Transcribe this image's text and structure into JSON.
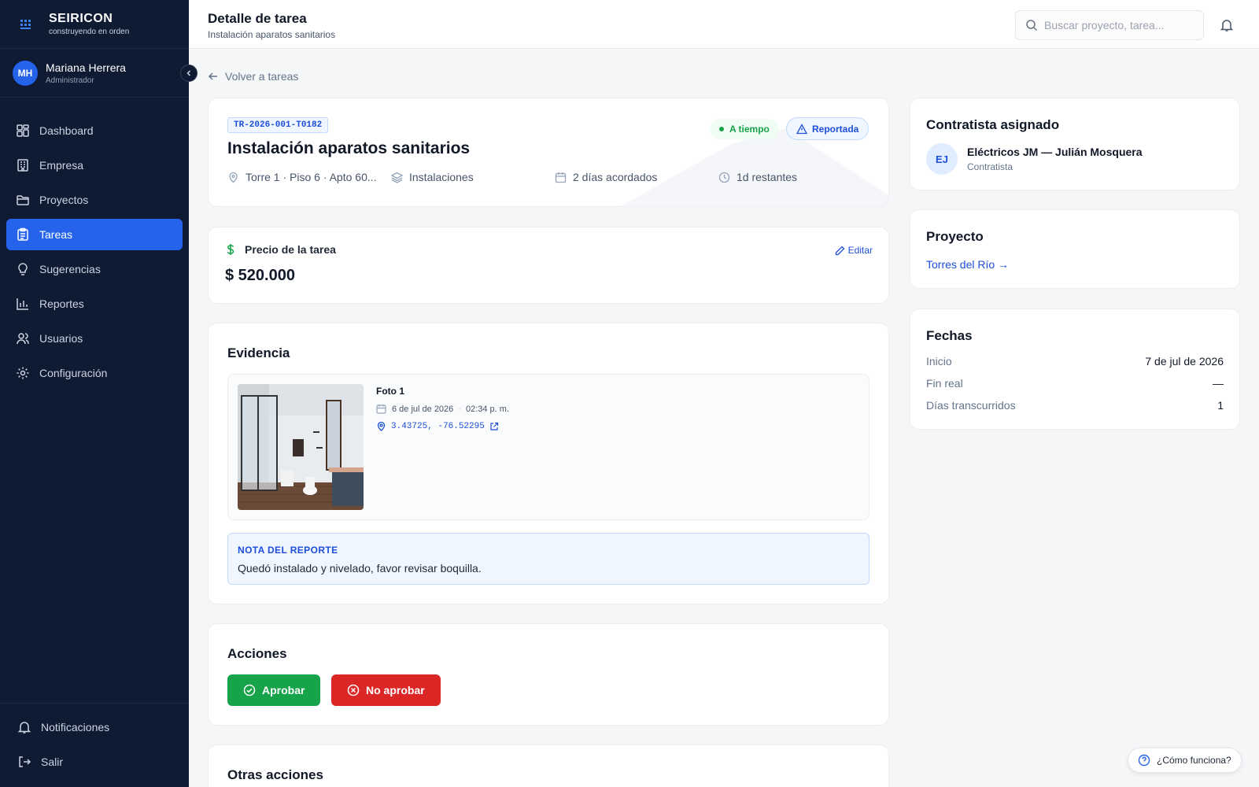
{
  "brand": {
    "name": "SEIRICON",
    "tagline": "construyendo en orden"
  },
  "user": {
    "initials": "MH",
    "name": "Mariana Herrera",
    "role": "Administrador"
  },
  "nav": {
    "items": [
      {
        "label": "Dashboard",
        "icon": "dashboard-icon"
      },
      {
        "label": "Empresa",
        "icon": "building-icon"
      },
      {
        "label": "Proyectos",
        "icon": "folder-icon"
      },
      {
        "label": "Tareas",
        "icon": "clipboard-icon",
        "active": true
      },
      {
        "label": "Sugerencias",
        "icon": "lightbulb-icon"
      },
      {
        "label": "Reportes",
        "icon": "bar-chart-icon"
      },
      {
        "label": "Usuarios",
        "icon": "users-icon"
      },
      {
        "label": "Configuración",
        "icon": "gear-icon"
      }
    ],
    "bottom": [
      {
        "label": "Notificaciones",
        "icon": "bell-icon"
      },
      {
        "label": "Salir",
        "icon": "logout-icon"
      }
    ]
  },
  "header": {
    "title": "Detalle de tarea",
    "subtitle": "Instalación aparatos sanitarios",
    "search_placeholder": "Buscar proyecto, tarea..."
  },
  "back_label": "Volver a tareas",
  "task": {
    "code": "TR-2026-001-T0182",
    "title": "Instalación aparatos sanitarios",
    "status_time": "A tiempo",
    "status_report": "Reportada",
    "location": "Torre 1 · Piso 6 · Apto 60...",
    "category": "Instalaciones",
    "agreed_days": "2 días acordados",
    "remaining": "1d restantes"
  },
  "price": {
    "label": "Precio de la tarea",
    "value": "$ 520.000",
    "edit_label": "Editar"
  },
  "evidence": {
    "title": "Evidencia",
    "photo": {
      "title": "Foto 1",
      "date": "6 de jul de 2026",
      "time": "02:34 p. m.",
      "coords": "3.43725, -76.52295"
    },
    "note_title": "NOTA DEL REPORTE",
    "note_text": "Quedó instalado y nivelado, favor revisar boquilla."
  },
  "actions": {
    "title": "Acciones",
    "approve": "Aprobar",
    "reject": "No aprobar"
  },
  "other_actions": {
    "title": "Otras acciones"
  },
  "contractor": {
    "title": "Contratista asignado",
    "initials": "EJ",
    "name": "Eléctricos JM — Julián Mosquera",
    "role": "Contratista"
  },
  "project": {
    "title": "Proyecto",
    "link": "Torres del Río →"
  },
  "dates": {
    "title": "Fechas",
    "rows": [
      {
        "label": "Inicio",
        "value": "7 de jul de 2026"
      },
      {
        "label": "Fin real",
        "value": "—"
      },
      {
        "label": "Días transcurridos",
        "value": "1"
      }
    ]
  },
  "help_label": "¿Cómo funciona?",
  "colors": {
    "primary": "#2563eb",
    "sidebar": "#0f1b33",
    "success": "#16a34a",
    "danger": "#dc2626"
  }
}
